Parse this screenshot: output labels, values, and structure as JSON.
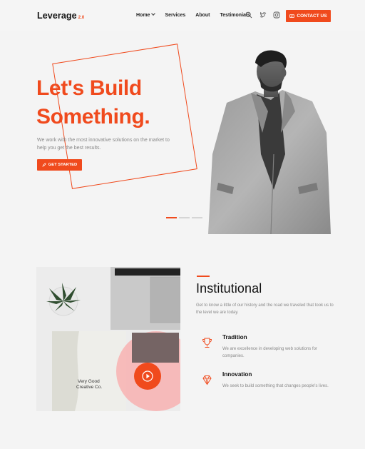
{
  "brand": {
    "name": "Leverage",
    "version": "2.0"
  },
  "nav": {
    "items": [
      {
        "label": "Home"
      },
      {
        "label": "Services"
      },
      {
        "label": "About"
      },
      {
        "label": "Testimonials"
      }
    ],
    "icons": [
      "search-icon",
      "twitter-icon",
      "instagram-icon"
    ],
    "contact_label": "CONTACT US"
  },
  "hero": {
    "title_line1": "Let's Build",
    "title_line2": "Something.",
    "description": "We work with the most innovative solutions on the market to help you get the best results.",
    "cta_label": "GET STARTED",
    "slides": 3,
    "active_slide": 1
  },
  "institutional": {
    "title": "Institutional",
    "description": "Get to know a little of our history and the road we traveled that took us to the level we are today.",
    "features": [
      {
        "icon": "trophy-icon",
        "title": "Tradition",
        "text": "We are excellence in developing web solutions for companies."
      },
      {
        "icon": "diamond-icon",
        "title": "Innovation",
        "text": "We seek to build something that changes people's lives."
      }
    ]
  },
  "photo": {
    "card_text_line1": "Very Good",
    "card_text_line2": "Creative Co."
  },
  "colors": {
    "accent": "#f04a1d",
    "background": "#f4f4f4",
    "text": "#222222",
    "muted": "#888888"
  }
}
